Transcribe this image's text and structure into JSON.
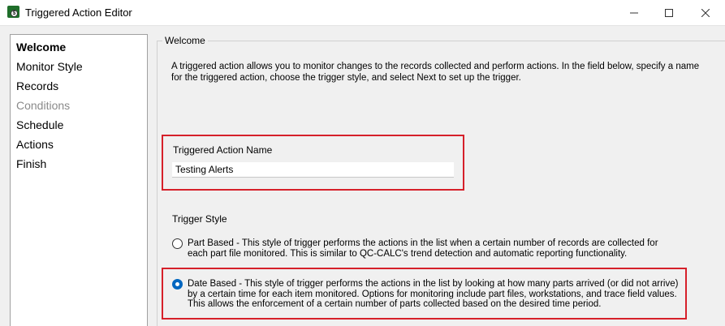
{
  "window": {
    "title": "Triggered Action Editor",
    "icon": "qc-calc-app-icon",
    "app_icon_glyph": "$"
  },
  "nav": {
    "items": [
      {
        "label": "Welcome",
        "state": "active"
      },
      {
        "label": "Monitor Style",
        "state": "normal"
      },
      {
        "label": "Records",
        "state": "normal"
      },
      {
        "label": "Conditions",
        "state": "disabled"
      },
      {
        "label": "Schedule",
        "state": "normal"
      },
      {
        "label": "Actions",
        "state": "normal"
      },
      {
        "label": "Finish",
        "state": "normal"
      }
    ]
  },
  "content": {
    "group_title": "Welcome",
    "intro": "A triggered action allows you to monitor changes to the records collected and perform actions. In the field below, specify a name for the triggered action, choose the trigger style, and select Next to set up the trigger.",
    "name_field": {
      "label": "Triggered Action Name",
      "value": "Testing Alerts"
    },
    "trigger_style": {
      "label": "Trigger Style",
      "options": [
        {
          "text": "Part Based - This style of trigger performs the actions in the list when a certain number of records are collected for each part file monitored. This is similar to QC-CALC's trend detection and automatic reporting functionality.",
          "selected": false
        },
        {
          "text": "Date Based - This style of trigger performs the actions in the list by looking at how many parts arrived (or did not arrive) by a certain time for each item monitored. Options for monitoring include part files, workstations, and trace field values. This allows the enforcement of a certain number of parts collected based on the desired time period.",
          "selected": true
        }
      ]
    }
  },
  "colors": {
    "highlight": "#d6202a",
    "accent": "#0067c0"
  }
}
